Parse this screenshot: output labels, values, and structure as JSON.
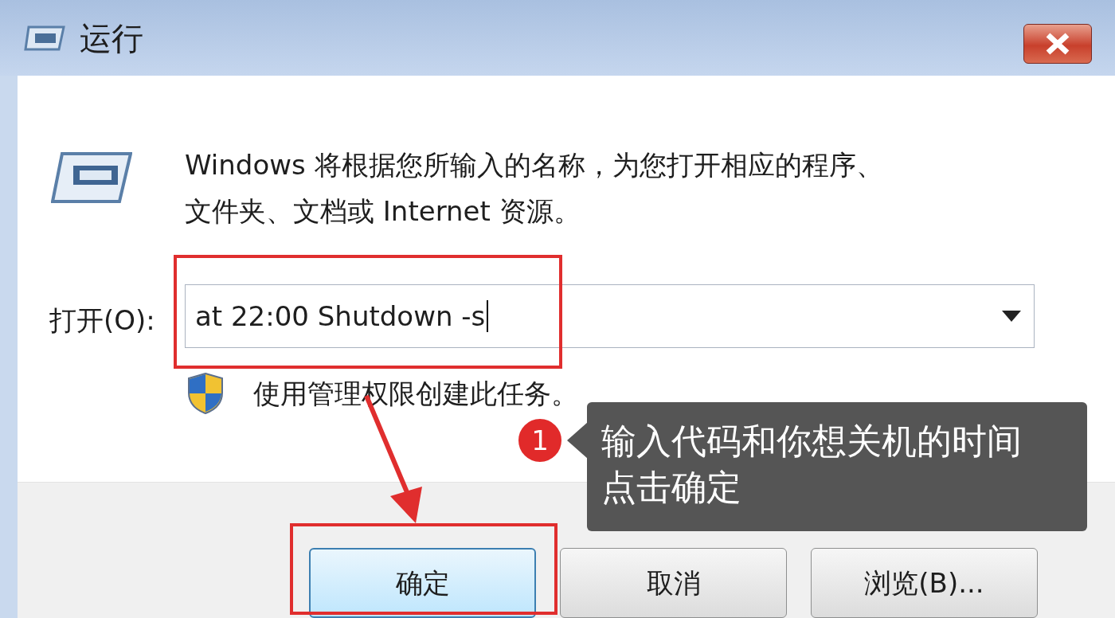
{
  "window": {
    "title": "运行"
  },
  "description": "Windows 将根据您所输入的名称，为您打开相应的程序、文件夹、文档或 Internet 资源。",
  "open_field": {
    "label": "打开(O):",
    "value": "at 22:00 Shutdown -s"
  },
  "admin_note": "使用管理权限创建此任务。",
  "buttons": [
    {
      "label": "确定",
      "selected": true
    },
    {
      "label": "取消",
      "selected": false
    },
    {
      "label": "浏览(B)...",
      "selected": false
    }
  ],
  "annotation": {
    "step": "1",
    "lines": [
      "输入代码和你想关机的时间",
      "点击确定"
    ]
  }
}
